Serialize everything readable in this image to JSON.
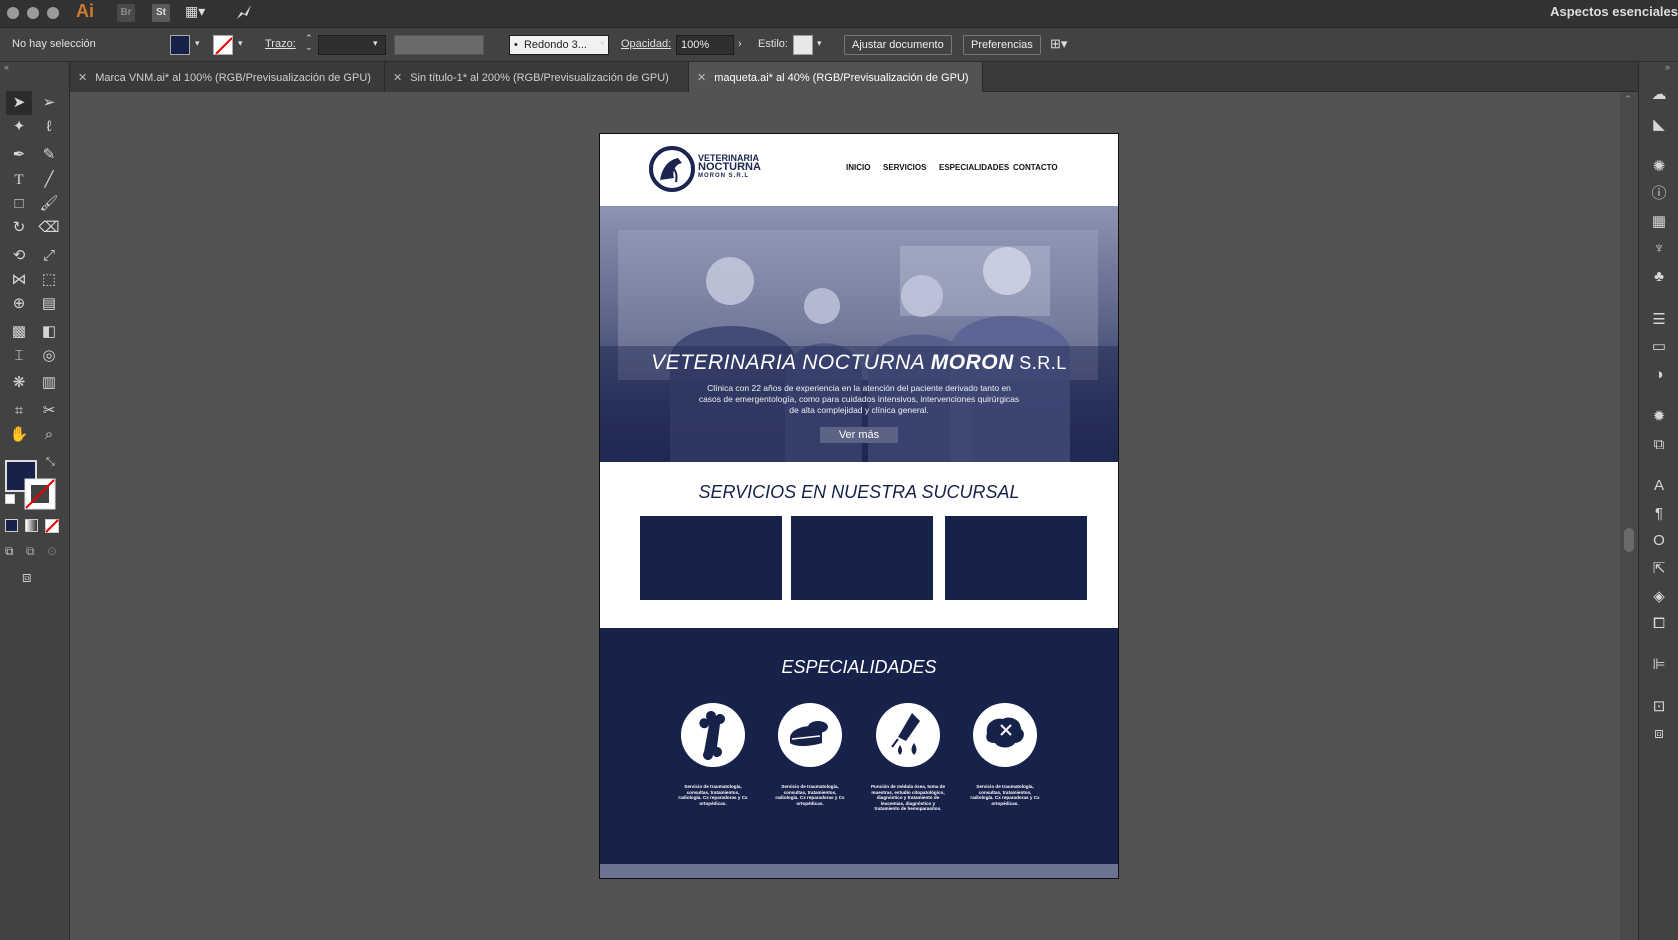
{
  "app": {
    "logo": "Ai",
    "bridge": "Br",
    "stock": "St",
    "workspace": "Aspectos esenciales"
  },
  "control": {
    "selection": "No hay selección",
    "stroke_label": "Trazo:",
    "brush_value": "Redondo 3...",
    "opacity_label": "Opacidad:",
    "opacity_value": "100%",
    "style_label": "Estilo:",
    "fit_doc": "Ajustar documento",
    "prefs": "Preferencias"
  },
  "tabs": [
    {
      "label": "Marca VNM.ai* al 100% (RGB/Previsualización de GPU)"
    },
    {
      "label": "Sin título-1* al 200% (RGB/Previsualización de GPU)"
    },
    {
      "label": "maqueta.ai* al 40% (RGB/Previsualización de GPU)"
    }
  ],
  "colors": {
    "fill": "#17224a",
    "navy": "#17224a",
    "ui_panel": "#424242",
    "canvas": "#535353"
  },
  "site": {
    "logo": {
      "line1": "VETERINARIA",
      "line2": "NOCTURNA",
      "line3": "MORON S.R.L"
    },
    "nav": [
      "INICIO",
      "SERVICIOS",
      "ESPECIALIDADES",
      "CONTACTO"
    ],
    "hero": {
      "title_a": "VETERINARIA NOCTURNA ",
      "title_b": "MORON",
      "title_c": " S.R.L",
      "text": "Clínica con 22 años de experiencia en la atención del paciente derivado tanto en casos de emergentología, como para cuidados intensivos, intervenciones quirúrgicas de alta complejidad y clínica general.",
      "button": "Ver más"
    },
    "services_title": "SERVICIOS EN NUESTRA SUCURSAL",
    "specialties_title": "ESPECIALIDADES",
    "specialties": [
      {
        "icon": "bone-icon",
        "text": "Servicio de traumatología, consultas, tratamientos, radiología. Cx reparadoras y Cx ortopédicas."
      },
      {
        "icon": "pet-food-icon",
        "text": "Servicio de traumatología, consultas, tratamientos, radiología. Cx reparadoras y Cx ortopédicas."
      },
      {
        "icon": "syringe-drop-icon",
        "text": "Punción de médula ósea, toma de muestras, estudio citopatológico, diagnóstico y tratamiento de leucemias, diagnóstico y tratamiento de hemoparasitos."
      },
      {
        "icon": "brain-icon",
        "text": "Servicio de traumatología, consultas, tratamientos, radiología. Cx reparadoras y Cx ortopédicas."
      }
    ]
  }
}
